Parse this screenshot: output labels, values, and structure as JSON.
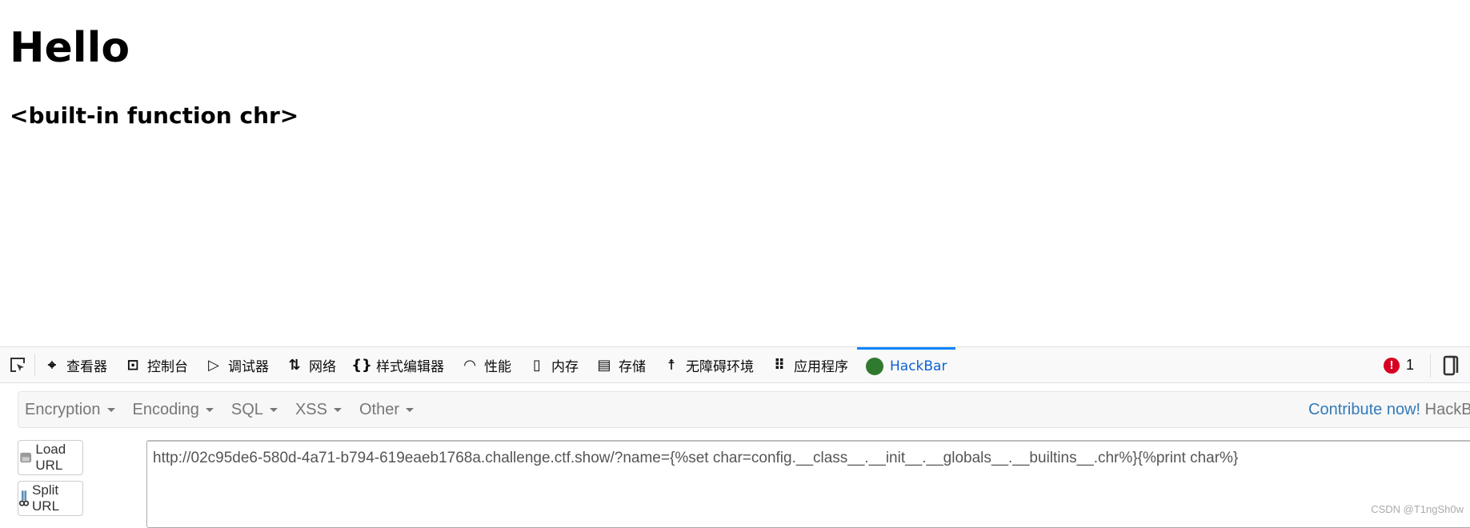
{
  "page": {
    "heading": "Hello",
    "subheading": "<built-in function chr>"
  },
  "devtools": {
    "tabs": [
      {
        "label": "查看器",
        "icon": "inspector-icon"
      },
      {
        "label": "控制台",
        "icon": "console-icon"
      },
      {
        "label": "调试器",
        "icon": "debugger-icon"
      },
      {
        "label": "网络",
        "icon": "network-icon"
      },
      {
        "label": "样式编辑器",
        "icon": "style-editor-icon"
      },
      {
        "label": "性能",
        "icon": "performance-icon"
      },
      {
        "label": "内存",
        "icon": "memory-icon"
      },
      {
        "label": "存储",
        "icon": "storage-icon"
      },
      {
        "label": "无障碍环境",
        "icon": "accessibility-icon"
      },
      {
        "label": "应用程序",
        "icon": "application-icon"
      },
      {
        "label": "HackBar",
        "icon": "hackbar-icon",
        "active": true
      }
    ],
    "error_count": "1",
    "accent": "#0a84ff"
  },
  "hackbar": {
    "menus": [
      "Encryption",
      "Encoding",
      "SQL",
      "XSS",
      "Other"
    ],
    "contribute": "Contribute now!",
    "contribute_suffix": "HackBar",
    "load_url": "Load URL",
    "split_url": "Split URL",
    "url": "http://02c95de6-580d-4a71-b794-619eaeb1768a.challenge.ctf.show/?name={%set char=config.__class__.__init__.__globals__.__builtins__.chr%}{%print char%}"
  },
  "watermark": "CSDN @T1ngSh0w"
}
